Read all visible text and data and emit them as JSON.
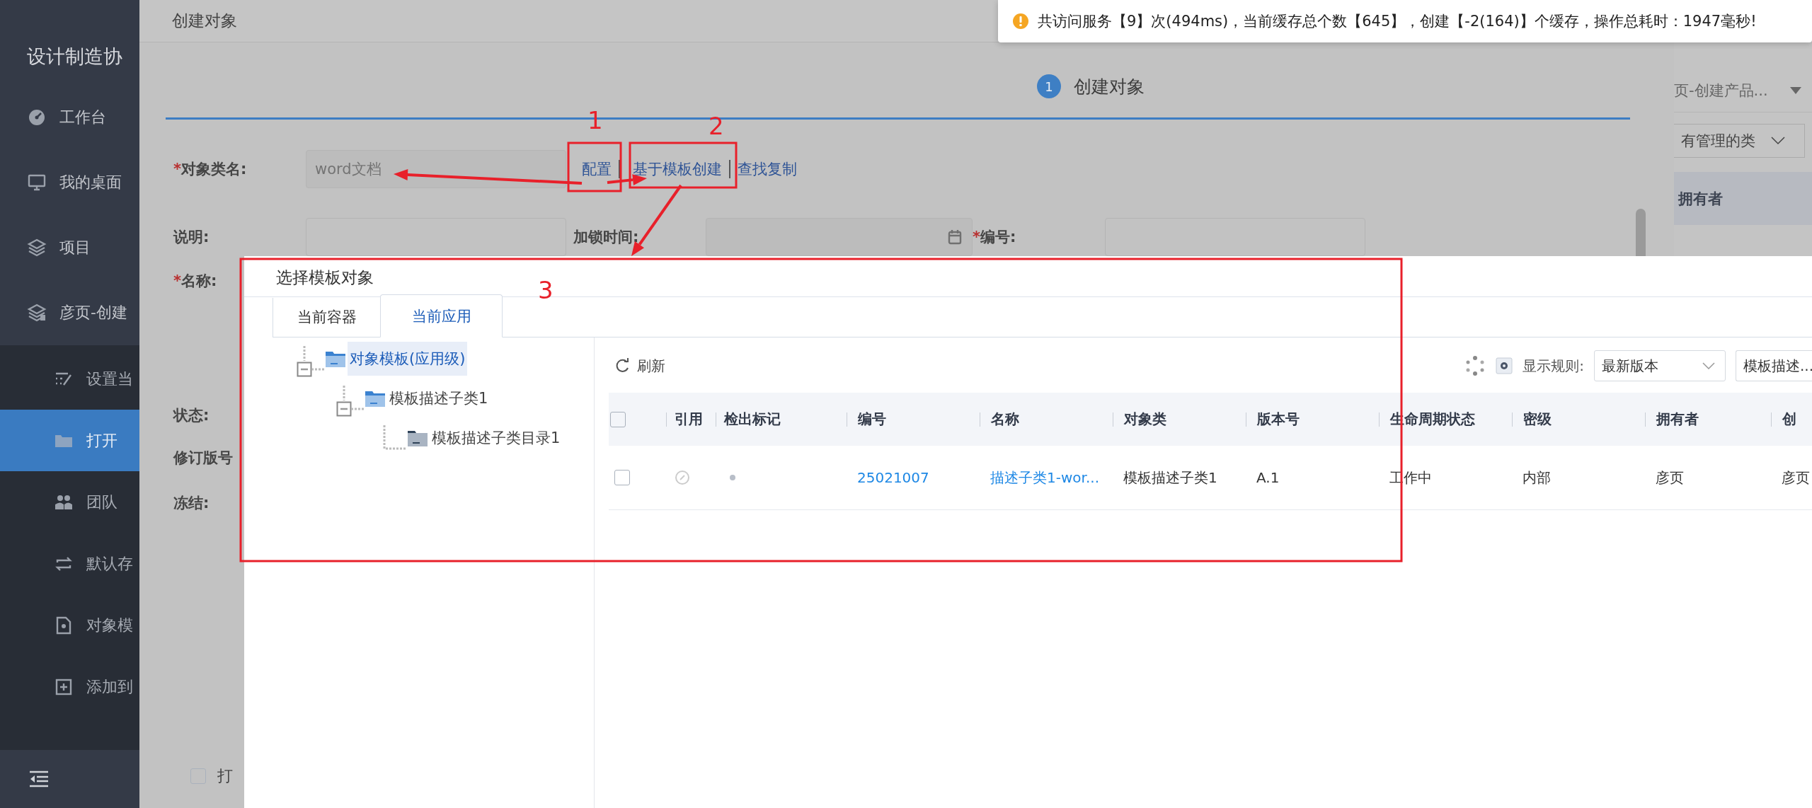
{
  "sidebar": {
    "title": "设计制造协",
    "items": [
      {
        "label": "工作台"
      },
      {
        "label": "我的桌面"
      },
      {
        "label": "项目"
      },
      {
        "label": "彦页-创建"
      }
    ],
    "sub_items": [
      {
        "label": "设置当",
        "selected": false
      },
      {
        "label": "打开",
        "selected": true
      },
      {
        "label": "团队",
        "selected": false
      },
      {
        "label": "默认存",
        "selected": false
      },
      {
        "label": "对象模",
        "selected": false
      },
      {
        "label": "添加到",
        "selected": false
      }
    ]
  },
  "create_dialog": {
    "title": "创建对象",
    "step": {
      "number": "1",
      "label": "创建对象"
    },
    "rows": [
      {
        "fields": [
          {
            "kind": "text",
            "required_mark": "*",
            "label": "对象类名:",
            "value": "word文档"
          }
        ],
        "links": [
          "配置",
          "基于模板创建",
          "查找复制"
        ]
      },
      {
        "fields": [
          {
            "kind": "input",
            "label": "说明:"
          },
          {
            "kind": "date",
            "label": "加锁时间:"
          },
          {
            "kind": "input",
            "required_mark": "*",
            "label": "编号:"
          }
        ]
      },
      {
        "fields": [
          {
            "kind": "label",
            "required_mark": "*",
            "label": "名称:"
          }
        ]
      },
      {
        "fields": [
          {
            "kind": "label",
            "label": "状态:"
          }
        ]
      },
      {
        "fields": [
          {
            "kind": "label",
            "label": "修订版号"
          }
        ]
      },
      {
        "fields": [
          {
            "kind": "label",
            "label": "冻结:"
          }
        ]
      }
    ],
    "footer": {
      "label": "打",
      "checked": false
    }
  },
  "background_panel": {
    "dropdown": "页-创建产品...",
    "select": "有管理的类",
    "column": "拥有者"
  },
  "toast": {
    "kind": "warning",
    "message": "共访问服务【9】次(494ms)，当前缓存总个数【645】，创建【-2(164)】个缓存，操作总耗时：1947毫秒!"
  },
  "template_dialog": {
    "title": "选择模板对象",
    "tabs": [
      {
        "label": "当前容器",
        "selected": false
      },
      {
        "label": "当前应用",
        "selected": true
      }
    ],
    "tree": [
      {
        "label": "对象模板(应用级)",
        "selected": true,
        "expanded": true,
        "children": [
          {
            "label": "模板描述子类1",
            "selected": false,
            "expanded": true,
            "children": [
              {
                "label": "模板描述子类目录1",
                "selected": false
              }
            ]
          }
        ]
      }
    ],
    "toolbar": {
      "refresh": "刷新",
      "rule_label": "显示规则:",
      "version_select": "最新版本",
      "type_select": "模板描述..."
    },
    "table": {
      "header_checked": false,
      "columns": [
        {
          "label": "引用",
          "kind": "ref"
        },
        {
          "label": "检出标记",
          "kind": "mark"
        },
        {
          "label": "编号",
          "kind": "link"
        },
        {
          "label": "名称",
          "kind": "link"
        },
        {
          "label": "对象类",
          "kind": "text"
        },
        {
          "label": "版本号",
          "kind": "text"
        },
        {
          "label": "生命周期状态",
          "kind": "text"
        },
        {
          "label": "密级",
          "kind": "text"
        },
        {
          "label": "拥有者",
          "kind": "text"
        },
        {
          "label": "创",
          "kind": "text"
        }
      ],
      "rows": [
        {
          "checked": false,
          "cells": [
            "",
            "",
            "25021007",
            "描述子类1-wor...",
            "模板描述子类1",
            "A.1",
            "工作中",
            "内部",
            "彦页",
            "彦页"
          ]
        }
      ]
    }
  },
  "annotations": [
    {
      "label": "1"
    },
    {
      "label": "2"
    },
    {
      "label": "3"
    }
  ]
}
